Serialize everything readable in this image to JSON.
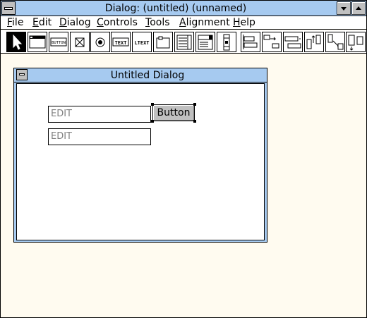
{
  "window": {
    "title": "Dialog: (untitled) (unnamed)"
  },
  "menu": {
    "items": [
      {
        "label": "File"
      },
      {
        "label": "Edit"
      },
      {
        "label": "Dialog"
      },
      {
        "label": "Controls"
      },
      {
        "label": "Tools"
      },
      {
        "label": "Alignment"
      },
      {
        "label": "Help"
      }
    ]
  },
  "toolbar": {
    "tools": [
      {
        "icon": "pointer-icon"
      },
      {
        "icon": "dialog-frame-icon"
      },
      {
        "icon": "button-tool-icon",
        "label": "BUTTON"
      },
      {
        "icon": "checkbox-tool-icon"
      },
      {
        "icon": "radio-tool-icon"
      },
      {
        "icon": "text-tool-icon",
        "label": "TEXT"
      },
      {
        "icon": "ltext-tool-icon",
        "label": "LTEXT"
      },
      {
        "icon": "groupbox-tool-icon"
      },
      {
        "icon": "listbox-tool-icon"
      },
      {
        "icon": "combobox-tool-icon"
      },
      {
        "icon": "scrollbar-tool-icon"
      },
      {
        "icon": "align-left-icon"
      },
      {
        "icon": "align-right-icon"
      },
      {
        "icon": "align-top-icon"
      },
      {
        "icon": "align-bottom-icon"
      },
      {
        "icon": "align-vcenter-icon"
      },
      {
        "icon": "align-hcenter-icon"
      }
    ]
  },
  "dialog": {
    "title": "Untitled Dialog",
    "controls": {
      "edit1": "EDIT",
      "edit2": "EDIT",
      "button": "Button"
    }
  },
  "colors": {
    "title_bar": "#a6caf0",
    "workspace": "#fffbf0",
    "button_face": "#c0c0c0"
  }
}
